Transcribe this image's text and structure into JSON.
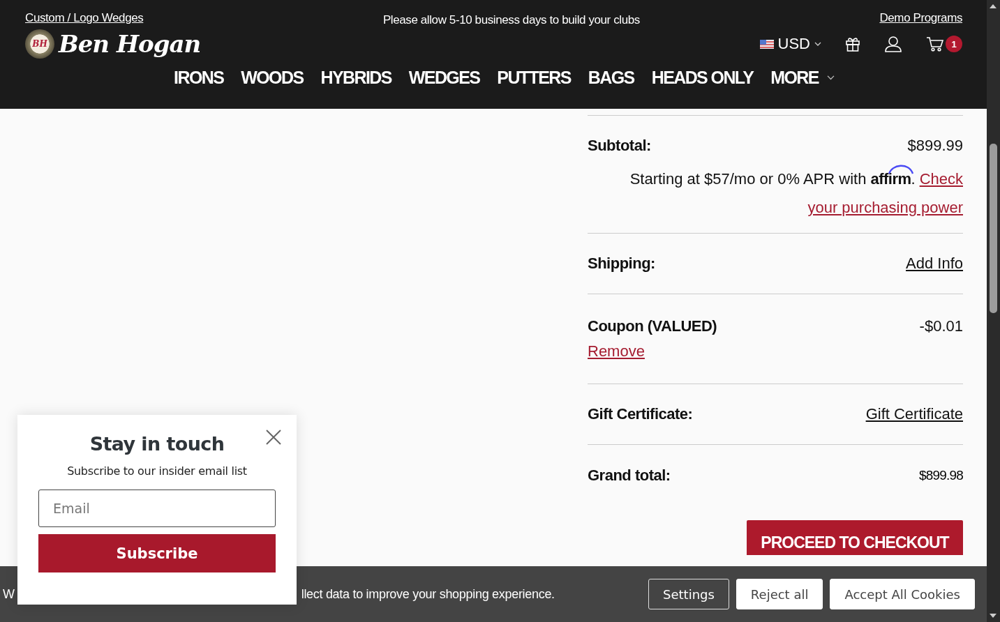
{
  "announcement": {
    "left_link": "Custom / Logo Wedges",
    "message": "Please allow 5-10 business days to build your clubs",
    "right_link": "Demo Programs"
  },
  "logo": {
    "emblem": "BH",
    "wordmark": "Ben Hogan"
  },
  "currency": {
    "label": "USD"
  },
  "cart": {
    "count": "1"
  },
  "nav": [
    {
      "label": "IRONS",
      "has_menu": false
    },
    {
      "label": "WOODS",
      "has_menu": false
    },
    {
      "label": "HYBRIDS",
      "has_menu": false
    },
    {
      "label": "WEDGES",
      "has_menu": false
    },
    {
      "label": "PUTTERS",
      "has_menu": false
    },
    {
      "label": "BAGS",
      "has_menu": false
    },
    {
      "label": "HEADS ONLY",
      "has_menu": false
    },
    {
      "label": "MORE",
      "has_menu": true
    }
  ],
  "summary": {
    "rows": [
      {
        "kind": "value",
        "label": "Subtotal:",
        "value": "$899.99"
      },
      {
        "kind": "affirm",
        "text": "Starting at $57/mo or 0% APR with",
        "brand": "affirm",
        "dot": ".",
        "link_lines": [
          "Check",
          "your purchasing power"
        ]
      },
      {
        "kind": "link",
        "label": "Shipping:",
        "link": "Add Info"
      },
      {
        "kind": "coupon",
        "label": "Coupon (VALUED)",
        "value": "-$0.01",
        "link": "Remove"
      },
      {
        "kind": "link",
        "label": "Gift Certificate:",
        "link": "Gift Certificate"
      },
      {
        "kind": "total",
        "label": "Grand total:",
        "value": "$899.98"
      }
    ],
    "checkout_button": "PROCEED TO CHECKOUT"
  },
  "popup": {
    "title": "Stay in touch",
    "subtitle": "Subscribe to our insider email list",
    "placeholder": "Email",
    "button": "Subscribe"
  },
  "cookie_bar": {
    "text_start": "W",
    "text_end": "llect data to improve your shopping experience.",
    "buttons": [
      {
        "label": "Settings",
        "kind": "outline"
      },
      {
        "label": "Reject all",
        "kind": "solid"
      },
      {
        "label": "Accept All Cookies",
        "kind": "solid"
      }
    ]
  }
}
